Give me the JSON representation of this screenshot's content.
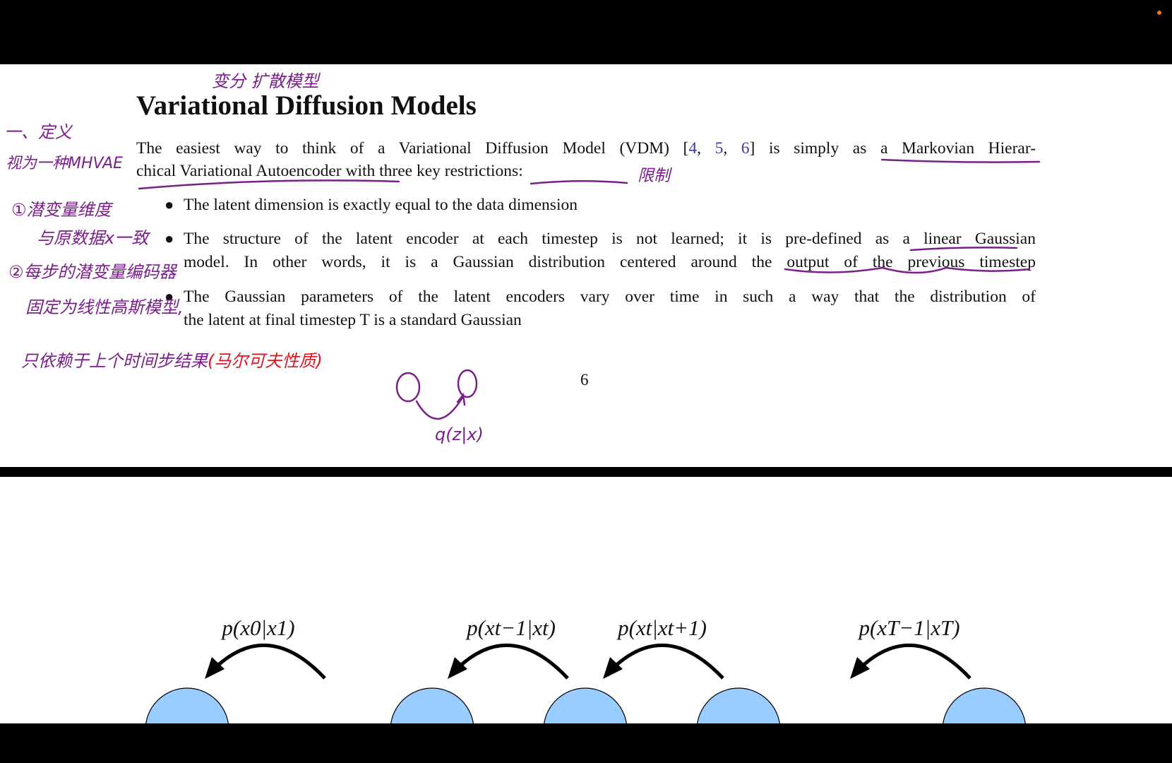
{
  "page1": {
    "title": "Variational Diffusion Models",
    "intro": {
      "line1_a": "The easiest way to think of a Variational Diffusion Model (VDM) [",
      "cite1": "4",
      "sep1": ", ",
      "cite2": "5",
      "sep2": ", ",
      "cite3": "6",
      "line1_b": "] is simply as a Markovian Hierar-",
      "line2": "chical Variational Autoencoder with three key restrictions:"
    },
    "bullets": [
      {
        "lines": [
          "The latent dimension is exactly equal to the data dimension"
        ]
      },
      {
        "lines": [
          "The structure of the latent encoder at each timestep is not learned; it is pre-defined as a linear Gaussian",
          "model. In other words, it is a Gaussian distribution centered around the output of the previous timestep"
        ]
      },
      {
        "lines": [
          "The Gaussian parameters of the latent encoders vary over time in such a way that the distribution of",
          "the latent at final timestep T is a standard Gaussian"
        ]
      }
    ],
    "page_number": "6"
  },
  "annotations": {
    "title_cn": "变分  扩散模型",
    "definition": "一、定义",
    "mhvae": "视为一种MHVAE",
    "restriction": "限制",
    "note1_a": "①潜变量维度",
    "note1_b": "与原数据x一致",
    "note2_a": "②每步的潜变量编码器",
    "note2_b": "固定为线性高斯模型,",
    "note3": "只依赖于上个时间步结果",
    "note3_red": "(马尔可夫性质)",
    "diagram": "q(z|x)",
    "color_purple": "#7a1f8a",
    "color_red": "#e0141e"
  },
  "page2": {
    "transitions": [
      "p(x0|x1)",
      "p(xt−1|xt)",
      "p(xt|xt+1)",
      "p(xT−1|xT)"
    ],
    "node_fill": "#99ccff"
  }
}
